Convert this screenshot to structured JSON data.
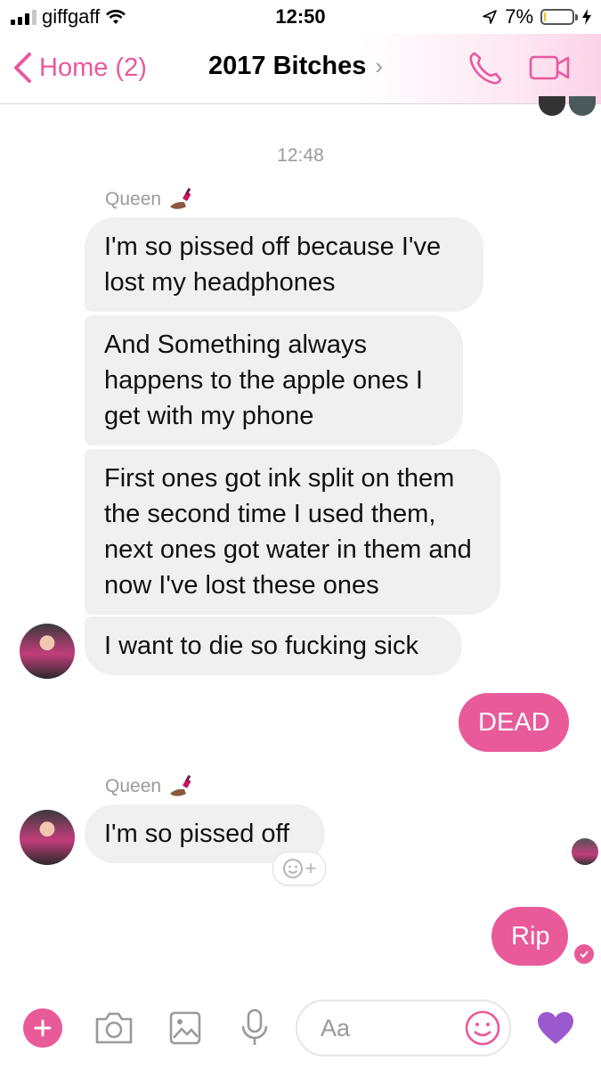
{
  "status": {
    "carrier": "giffgaff",
    "time": "12:50",
    "battery_percent": "7%",
    "battery_level": 0.07,
    "signal_bars": 3
  },
  "nav": {
    "back_label": "Home (2)",
    "title": "2017 Bitches",
    "accent": "#e8589f"
  },
  "chat": {
    "timestamp": "12:48",
    "group1": {
      "sender": "Queen",
      "messages": [
        "I'm so pissed off because I've lost my headphones",
        "And Something always happens to the apple ones I get with my phone",
        "First ones got ink split on them the second time I used them, next ones got water in them and now I've lost these ones",
        "I want to die so fucking sick"
      ]
    },
    "me1": "DEAD",
    "group2": {
      "sender": "Queen",
      "messages": [
        "I'm so pissed off"
      ]
    },
    "me2": "Rip"
  },
  "composer": {
    "placeholder": "Aa",
    "icons": [
      "plus-icon",
      "camera-icon",
      "photo-icon",
      "microphone-icon",
      "emoji-icon",
      "heart-icon"
    ]
  },
  "colors": {
    "my_bubble": "#e85a9a",
    "their_bubble": "#f1f0f0",
    "heart": "#9b59d0"
  }
}
